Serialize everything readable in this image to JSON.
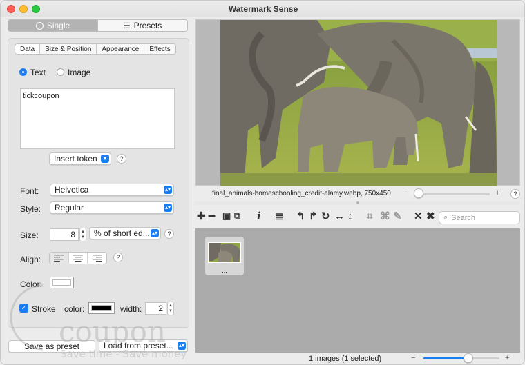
{
  "window": {
    "title": "Watermark Sense"
  },
  "mode_tabs": [
    {
      "label": "Single",
      "icon": "circle-ring-icon"
    },
    {
      "label": "Presets",
      "icon": "list-icon"
    }
  ],
  "settings_tabs": [
    "Data",
    "Size & Position",
    "Appearance",
    "Effects"
  ],
  "data_panel": {
    "type_options": [
      {
        "label": "Text",
        "selected": true
      },
      {
        "label": "Image",
        "selected": false
      }
    ],
    "text_value": "tickcoupon",
    "insert_token_label": "Insert token",
    "font_label": "Font:",
    "font_value": "Helvetica",
    "style_label": "Style:",
    "style_value": "Regular",
    "size_label": "Size:",
    "size_value": "8",
    "size_unit": "% of short ed...",
    "align_label": "Align:",
    "color_label": "Color:",
    "color_value": "#ffffff",
    "stroke_label": "Stroke",
    "stroke_checked": true,
    "stroke_color_label": "color:",
    "stroke_color_value": "#000000",
    "stroke_width_label": "width:",
    "stroke_width_value": "2",
    "help": "?"
  },
  "bottom_buttons": {
    "save_preset": "Save as preset",
    "load_preset": "Load from preset..."
  },
  "preview": {
    "filename": "final_animals-homeschooling_credit-alamy.webp,  750x450",
    "zoom_minus": "−",
    "zoom_plus": "+",
    "help": "?",
    "zoom_level": 0.0
  },
  "toolbar": {
    "icons": [
      "plus-icon",
      "minus-icon",
      "save-icon",
      "save-all-icon",
      "info-icon",
      "list-icon",
      "rotate-left-icon",
      "rotate-right-icon",
      "rotate-icon",
      "flip-horizontal-icon",
      "flip-vertical-icon",
      "crop-icon",
      "crop-auto-icon",
      "watermark-icon",
      "remove-icon",
      "remove-all-icon"
    ],
    "search_placeholder": "Search"
  },
  "thumbnails": [
    {
      "name": "..."
    }
  ],
  "status": {
    "text": "1 images (1 selected)",
    "minus": "−",
    "plus": "+",
    "thumb_size": 0.6
  },
  "watermark_overlay": {
    "brand": "coupon",
    "tagline": "Save time - Save money"
  },
  "colors": {
    "accent": "#1a7df2",
    "browser_bg": "#ababab"
  }
}
